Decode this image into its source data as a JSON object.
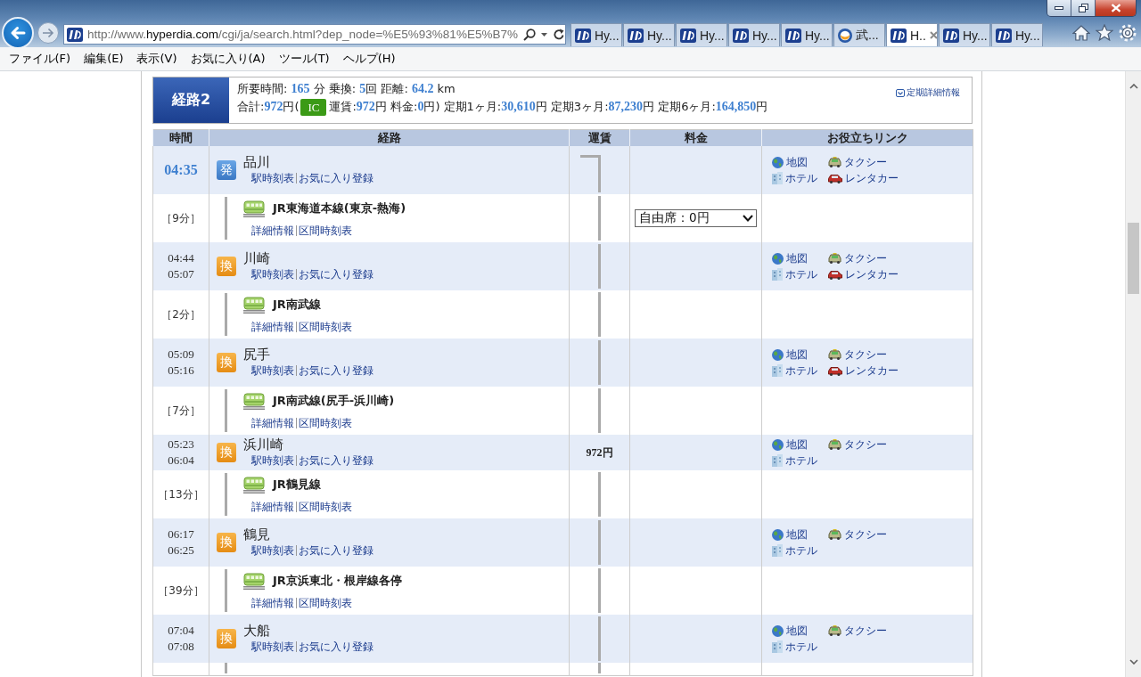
{
  "browser": {
    "url": {
      "scheme": "http://www.",
      "domain": "hyperdia.com",
      "path": "/cgi/ja/search.html?dep_node=%E5%93%81%E5%B7%"
    },
    "tabs": [
      {
        "label": "Hy...",
        "kind": "square",
        "selected": false
      },
      {
        "label": "Hy...",
        "kind": "square",
        "selected": false
      },
      {
        "label": "Hy...",
        "kind": "square",
        "selected": false
      },
      {
        "label": "Hy...",
        "kind": "square",
        "selected": false
      },
      {
        "label": "Hy...",
        "kind": "square",
        "selected": false
      },
      {
        "label": "武...",
        "kind": "round",
        "selected": false
      },
      {
        "label": "H..",
        "kind": "square",
        "selected": true
      },
      {
        "label": "Hy...",
        "kind": "square",
        "selected": false
      },
      {
        "label": "Hy...",
        "kind": "square",
        "selected": false
      }
    ],
    "menu": [
      "ファイル(F)",
      "編集(E)",
      "表示(V)",
      "お気に入り(A)",
      "ツール(T)",
      "ヘルプ(H)"
    ]
  },
  "summary": {
    "route_label": "経路2",
    "line1": "所要時間: **165** 分 乗換: **5**回 距離: **64.2** km",
    "total": "合計:**972**円(",
    "ic_badge": "IC",
    "breakdown": "運賃:**972**円 料金:**0**円) 定期1ヶ月:**30,610**円 定期3ヶ月:**87,230**円 定期6ヶ月:**164,850**円",
    "pass_link": "定期詳細情報"
  },
  "table": {
    "columns": [
      "時間",
      "経路",
      "運賃",
      "料金",
      "お役立ちリンク"
    ],
    "rows": [
      {
        "kind": "departure",
        "badge": "発",
        "times": [
          "04:35"
        ],
        "name": "品川",
        "links": [
          "駅時刻表",
          "お気に入り登録"
        ],
        "fare_line": true,
        "line_start": true,
        "useful_links": [
          {
            "kind": "map",
            "label": "地図"
          },
          {
            "kind": "taxi",
            "label": "タクシー"
          },
          {
            "kind": "hotel",
            "label": "ホテル"
          },
          {
            "kind": "rental_car",
            "label": "レンタカー"
          }
        ]
      },
      {
        "kind": "train",
        "duration": "［9分］",
        "line": "JR東海道本線(東京-熱海)",
        "links": [
          "詳細情報",
          "区間時刻表"
        ],
        "fare_line": true,
        "line_start": false,
        "charge": "自由席：0円"
      },
      {
        "kind": "transfer",
        "badge": "換",
        "times": [
          "04:44",
          "05:07"
        ],
        "name": "川崎",
        "links": [
          "駅時刻表",
          "お気に入り登録"
        ],
        "fare_line": true,
        "line_start": false,
        "useful_links": [
          {
            "kind": "map",
            "label": "地図"
          },
          {
            "kind": "taxi",
            "label": "タクシー"
          },
          {
            "kind": "hotel",
            "label": "ホテル"
          },
          {
            "kind": "rental_car",
            "label": "レンタカー"
          }
        ]
      },
      {
        "kind": "train",
        "duration": "［2分］",
        "line": "JR南武線",
        "links": [
          "詳細情報",
          "区間時刻表"
        ],
        "fare_line": true,
        "line_start": false
      },
      {
        "kind": "transfer",
        "badge": "換",
        "times": [
          "05:09",
          "05:16"
        ],
        "name": "尻手",
        "links": [
          "駅時刻表",
          "お気に入り登録"
        ],
        "fare_line": true,
        "line_start": false,
        "useful_links": [
          {
            "kind": "map",
            "label": "地図"
          },
          {
            "kind": "taxi",
            "label": "タクシー"
          },
          {
            "kind": "hotel",
            "label": "ホテル"
          },
          {
            "kind": "rental_car",
            "label": "レンタカー"
          }
        ]
      },
      {
        "kind": "train",
        "duration": "［7分］",
        "line": "JR南武線(尻手-浜川崎)",
        "links": [
          "詳細情報",
          "区間時刻表"
        ],
        "fare_line": true,
        "line_start": false
      },
      {
        "kind": "transfer",
        "badge": "換",
        "times": [
          "05:23",
          "06:04"
        ],
        "name": "浜川崎",
        "links": [
          "駅時刻表",
          "お気に入り登録"
        ],
        "fare": "972円",
        "useful_links": [
          {
            "kind": "map",
            "label": "地図"
          },
          {
            "kind": "taxi",
            "label": "タクシー"
          },
          {
            "kind": "hotel",
            "label": "ホテル"
          }
        ]
      },
      {
        "kind": "train",
        "duration": "［13分］",
        "line": "JR鶴見線",
        "links": [
          "詳細情報",
          "区間時刻表"
        ],
        "fare_line": true,
        "line_start": false
      },
      {
        "kind": "transfer",
        "badge": "換",
        "times": [
          "06:17",
          "06:25"
        ],
        "name": "鶴見",
        "links": [
          "駅時刻表",
          "お気に入り登録"
        ],
        "fare_line": true,
        "line_start": false,
        "useful_links": [
          {
            "kind": "map",
            "label": "地図"
          },
          {
            "kind": "taxi",
            "label": "タクシー"
          },
          {
            "kind": "hotel",
            "label": "ホテル"
          }
        ]
      },
      {
        "kind": "train",
        "duration": "［39分］",
        "line": "JR京浜東北・根岸線各停",
        "links": [
          "詳細情報",
          "区間時刻表"
        ],
        "fare_line": true,
        "line_start": false
      },
      {
        "kind": "transfer",
        "badge": "換",
        "times": [
          "07:04",
          "07:08"
        ],
        "name": "大船",
        "links": [
          "駅時刻表",
          "お気に入り登録"
        ],
        "fare_line": true,
        "line_start": false,
        "useful_links": [
          {
            "kind": "map",
            "label": "地図"
          },
          {
            "kind": "taxi",
            "label": "タクシー"
          },
          {
            "kind": "hotel",
            "label": "ホテル"
          }
        ]
      },
      {
        "kind": "cut",
        "fare_line": true,
        "line_start": false
      }
    ]
  }
}
